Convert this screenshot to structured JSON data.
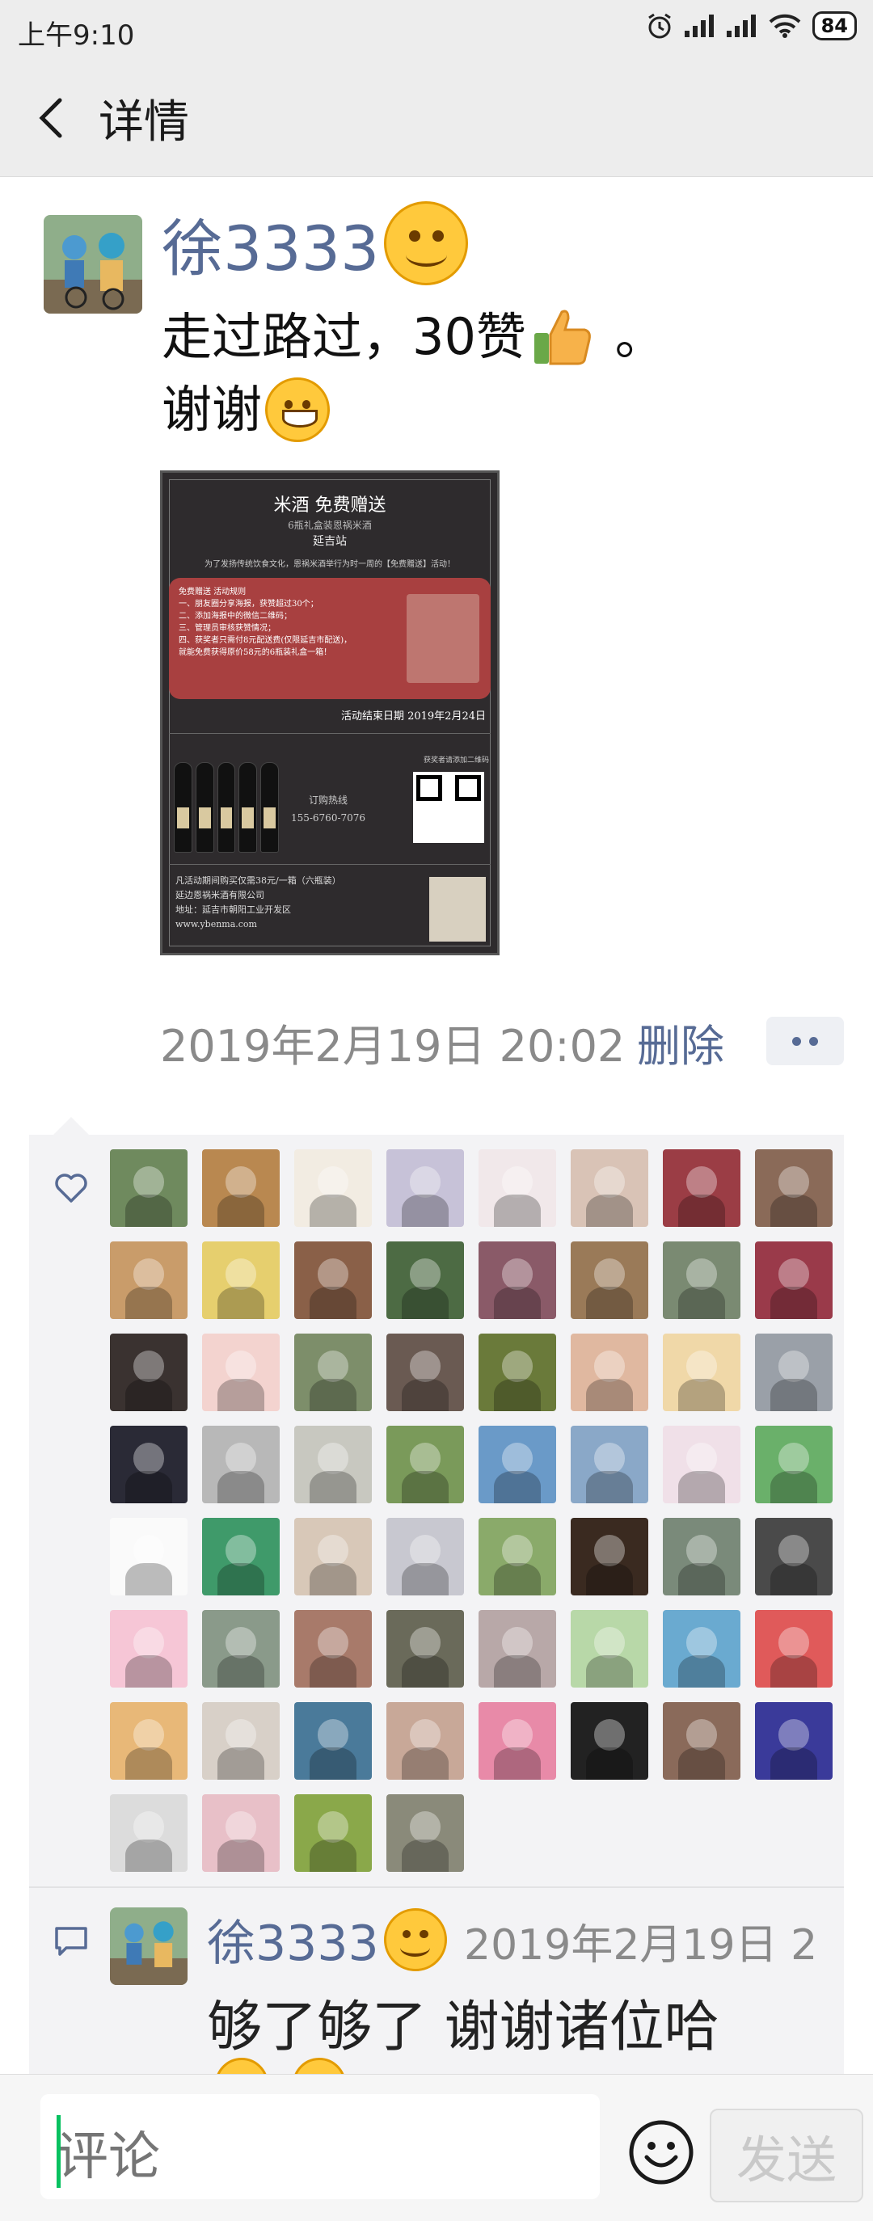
{
  "status_bar": {
    "time": "上午9:10",
    "battery": "84"
  },
  "nav": {
    "title": "详情"
  },
  "post": {
    "author": "徐3333",
    "text_line1": "走过路过，30赞",
    "text_line1_end": " 。",
    "text_line2": "谢谢",
    "timestamp": "2019年2月19日 20:02",
    "delete_label": "删除"
  },
  "poster": {
    "title": "米酒 免费赠送",
    "subtitle": "6瓶礼盒装恩祸米酒",
    "station": "延吉站",
    "intro": "为了发扬传统饮食文化，恩祸米酒举行为时一周的【免费赠送】活动！",
    "rules": [
      "免费赠送 活动规则",
      "一、朋友圈分享海报，获赞超过30个；",
      "二、添加海报中的微信二维码；",
      "三、管理员审核获赞情况；",
      "四、获奖者只需付8元配送费(仅限延吉市配送)，",
      "就能免费获得原价58元的6瓶装礼盒一箱！"
    ],
    "end_date": "活动结束日期 2019年2月24日",
    "hotline_label": "订购热线",
    "hotline": "155-6760-7076",
    "qr_label": "获奖者请添加二维码",
    "footer": [
      "凡活动期间购买仅需38元/一箱（六瓶装）",
      "延边恩祸米酒有限公司",
      "地址：延吉市朝阳工业开发区",
      "www.ybenma.com"
    ]
  },
  "likes": {
    "colors": [
      "#6f8a5e",
      "#b98850",
      "#f2ece2",
      "#c7c2d8",
      "#f1e8ea",
      "#d9c3b6",
      "#9b3d45",
      "#8a6a58",
      "#c99c6a",
      "#e6cf6e",
      "#8a6048",
      "#4d6b44",
      "#8a5a68",
      "#9a7a58",
      "#7a8a72",
      "#9a3a4a",
      "#3a3230",
      "#f3d3cf",
      "#7d8e6a",
      "#6a5a52",
      "#6a7a3a",
      "#e0b8a0",
      "#f0d8a8",
      "#9aa0a8",
      "#2a2a36",
      "#b8b8b8",
      "#c8c8c0",
      "#7a9a5a",
      "#6a9ac8",
      "#8aa8c8",
      "#f0e0e8",
      "#6ab06a",
      "#fafafa",
      "#3f9a6a",
      "#d8c8b8",
      "#c8c8d0",
      "#8aaa6a",
      "#3a2a20",
      "#7a8a7a",
      "#4a4a4a",
      "#f6c6d6",
      "#8a9a8a",
      "#a87a6a",
      "#6a6a5a",
      "#b8a8a8",
      "#b8d8a8",
      "#6aaad0",
      "#e05a5a",
      "#e8b878",
      "#d8d0c8",
      "#4a7a9a",
      "#c8a898",
      "#e88aa8",
      "#222222",
      "#8a6a5a",
      "#3a3a9a",
      "#dcdcdc",
      "#e8c0c8",
      "#8aa84a",
      "#8a8a7a"
    ]
  },
  "comment": {
    "author": "徐3333",
    "time": "2019年2月19日 2",
    "text": "够了够了  谢谢诸位哈"
  },
  "input": {
    "placeholder": "评论",
    "send_label": "发送"
  },
  "theme": {
    "link": "#576b95",
    "bg_nav": "#ededed",
    "panel": "#f3f3f5",
    "accent": "#07c160"
  },
  "icons": [
    "back-arrow-icon",
    "alarm-icon",
    "signal-icon",
    "wifi-icon",
    "battery-icon",
    "heart-icon",
    "comment-icon",
    "emoji-icon",
    "more-icon"
  ]
}
